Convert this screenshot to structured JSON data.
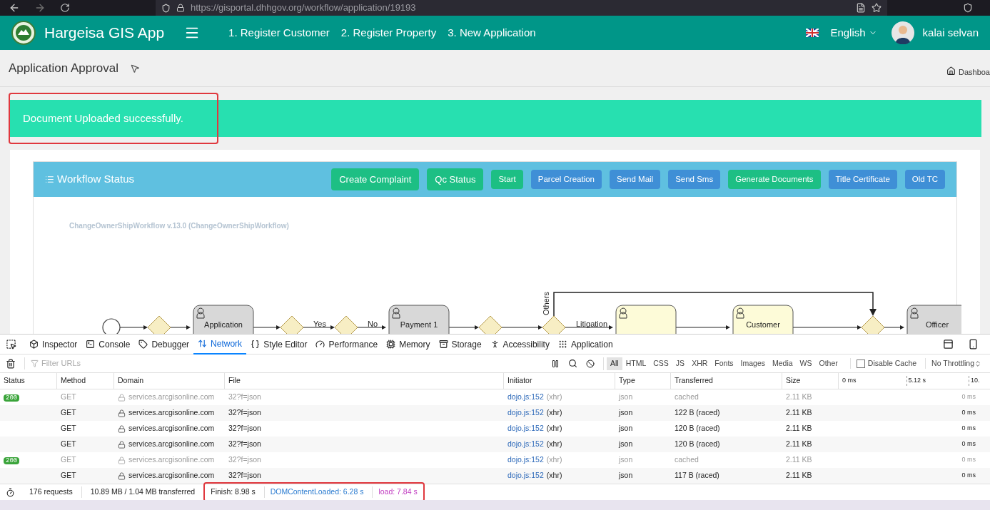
{
  "browser": {
    "url": "https://gisportal.dhhgov.org/workflow/application/19193"
  },
  "app": {
    "title": "Hargeisa GIS App",
    "nav": [
      "1. Register Customer",
      "2. Register Property",
      "3. New Application"
    ],
    "language": "English",
    "user": "kalai selvan"
  },
  "page": {
    "title": "Application Approval",
    "breadcrumb": "Dashboa"
  },
  "alert": {
    "message": "Document Uploaded successfully.",
    "highlighted": true
  },
  "workflow": {
    "title": "Workflow Status",
    "buttons": [
      {
        "label": "Create Complaint",
        "kind": "success"
      },
      {
        "label": "Qc Status",
        "kind": "success"
      },
      {
        "label": "Start",
        "kind": "success"
      },
      {
        "label": "Parcel Creation",
        "kind": "primary"
      },
      {
        "label": "Send Mail",
        "kind": "primary"
      },
      {
        "label": "Send Sms",
        "kind": "primary"
      },
      {
        "label": "Generate Documents",
        "kind": "success"
      },
      {
        "label": "Title Certificate",
        "kind": "primary"
      },
      {
        "label": "Old TC",
        "kind": "primary"
      }
    ],
    "diagram": {
      "title": "ChangeOwnerShipWorkflow v.13.0 (ChangeOwnerShipWorkflow)",
      "tasks": [
        {
          "label": "Application",
          "active": false
        },
        {
          "label": "Payment 1",
          "active": false
        },
        {
          "active": true
        },
        {
          "label": "Customer",
          "active": true
        },
        {
          "label": "Officer",
          "active": false
        }
      ],
      "flow_labels": [
        "Yes",
        "No",
        "Others",
        "Litigation"
      ]
    }
  },
  "devtools": {
    "tabs": [
      {
        "label": "Inspector",
        "selected": false
      },
      {
        "label": "Console",
        "selected": false
      },
      {
        "label": "Debugger",
        "selected": false
      },
      {
        "label": "Network",
        "selected": true
      },
      {
        "label": "Style Editor",
        "selected": false
      },
      {
        "label": "Performance",
        "selected": false
      },
      {
        "label": "Memory",
        "selected": false
      },
      {
        "label": "Storage",
        "selected": false
      },
      {
        "label": "Accessibility",
        "selected": false
      },
      {
        "label": "Application",
        "selected": false
      }
    ],
    "filter": {
      "placeholder": "Filter URLs"
    },
    "types": [
      {
        "label": "All",
        "selected": true
      },
      {
        "label": "HTML",
        "selected": false
      },
      {
        "label": "CSS",
        "selected": false
      },
      {
        "label": "JS",
        "selected": false
      },
      {
        "label": "XHR",
        "selected": false
      },
      {
        "label": "Fonts",
        "selected": false
      },
      {
        "label": "Images",
        "selected": false
      },
      {
        "label": "Media",
        "selected": false
      },
      {
        "label": "WS",
        "selected": false
      },
      {
        "label": "Other",
        "selected": false
      }
    ],
    "disable_cache": {
      "label": "Disable Cache",
      "checked": false
    },
    "throttling": "No Throttling",
    "columns": [
      "Status",
      "Method",
      "Domain",
      "File",
      "Initiator",
      "Type",
      "Transferred",
      "Size"
    ],
    "timeline_ticks": [
      "0 ms",
      "5.12 s",
      "10."
    ],
    "rows": [
      {
        "status": "200",
        "method": "GET",
        "domain": "services.arcgisonline.com",
        "file": "32?f=json",
        "initiator": "dojo.js:152",
        "cause": "(xhr)",
        "type": "json",
        "transferred": "cached",
        "size": "2.11 KB",
        "timing": "0 ms",
        "dimmed": true
      },
      {
        "method": "GET",
        "domain": "services.arcgisonline.com",
        "file": "32?f=json",
        "initiator": "dojo.js:152",
        "cause": "(xhr)",
        "type": "json",
        "transferred": "122 B (raced)",
        "size": "2.11 KB",
        "timing": "0 ms",
        "dimmed": false
      },
      {
        "method": "GET",
        "domain": "services.arcgisonline.com",
        "file": "32?f=json",
        "initiator": "dojo.js:152",
        "cause": "(xhr)",
        "type": "json",
        "transferred": "120 B (raced)",
        "size": "2.11 KB",
        "timing": "0 ms",
        "dimmed": false
      },
      {
        "method": "GET",
        "domain": "services.arcgisonline.com",
        "file": "32?f=json",
        "initiator": "dojo.js:152",
        "cause": "(xhr)",
        "type": "json",
        "transferred": "120 B (raced)",
        "size": "2.11 KB",
        "timing": "0 ms",
        "dimmed": false
      },
      {
        "status": "200",
        "method": "GET",
        "domain": "services.arcgisonline.com",
        "file": "32?f=json",
        "initiator": "dojo.js:152",
        "cause": "(xhr)",
        "type": "json",
        "transferred": "cached",
        "size": "2.11 KB",
        "timing": "0 ms",
        "dimmed": true
      },
      {
        "method": "GET",
        "domain": "services.arcgisonline.com",
        "file": "32?f=json",
        "initiator": "dojo.js:152",
        "cause": "(xhr)",
        "type": "json",
        "transferred": "117 B (raced)",
        "size": "2.11 KB",
        "timing": "0 ms",
        "dimmed": false
      }
    ],
    "summary": {
      "requests": "176 requests",
      "transferred": "10.89 MB / 1.04 MB transferred",
      "finish": "Finish: 8.98 s",
      "dom_loaded": "DOMContentLoaded: 6.28 s",
      "load": "load: 7.84 s",
      "highlighted": true
    }
  }
}
